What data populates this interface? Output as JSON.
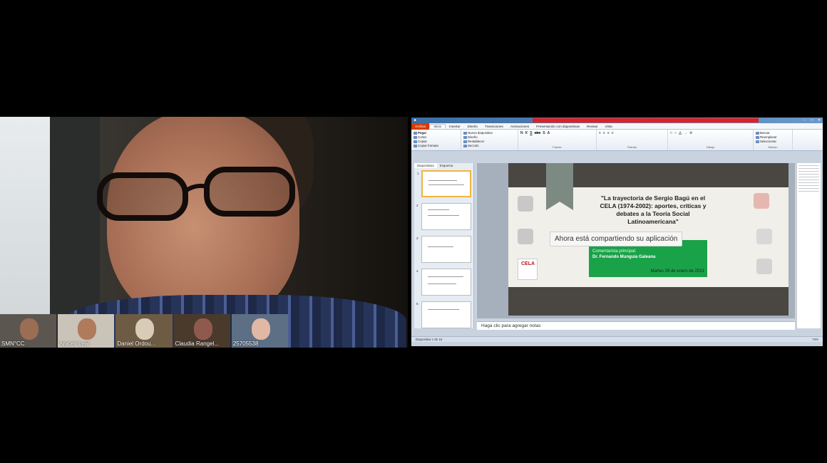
{
  "speaker": {},
  "participants": [
    {
      "name": "SMN°CC"
    },
    {
      "name": "Araceli Leal"
    },
    {
      "name": "Daniel Ordou..."
    },
    {
      "name": "Claudia Rangel..."
    },
    {
      "name": "25705538"
    }
  ],
  "powerpoint": {
    "file_tab": "Archivo",
    "tabs": [
      "Inicio",
      "Insertar",
      "Diseño",
      "Transiciones",
      "Animaciones",
      "Presentación con diapositivas",
      "Revisar",
      "Vista"
    ],
    "clipboard": {
      "paste": "Pegar",
      "cut": "Cortar",
      "copy": "Copiar",
      "format": "Copiar formato",
      "label": "Portapapeles"
    },
    "slides_group": {
      "new_slide": "Nueva diapositiva",
      "layout": "Diseño",
      "reset": "Restablecer",
      "section": "Sección",
      "label": "Diapositivas"
    },
    "font_label": "Fuente",
    "paragraph_label": "Párrafo",
    "drawing_label": "Dibujo",
    "editing": {
      "find": "Buscar",
      "replace": "Reemplazar",
      "select": "Seleccionar",
      "label": "Edición"
    },
    "panel_tabs": [
      "Diapositivas",
      "Esquema"
    ]
  },
  "slide": {
    "title": "\"La trayectoria de Sergio Bagú en el CELA (1974-2002): aportes, críticas y debates a la Teoría Social Latinoamericana\"",
    "commentator_label": "Comentarista principal:",
    "commentator": "Dr. Fernando Munguía Galeana",
    "date": "Martes 26 de enero de 2021",
    "cela_logo": "CELA"
  },
  "overlay": {
    "sharing": "Ahora está compartiendo su aplicación"
  },
  "notes_placeholder": "Haga clic para agregar notas",
  "status_bar": {
    "slide_count": "Diapositiva 1 de 15",
    "zoom": "74%"
  }
}
